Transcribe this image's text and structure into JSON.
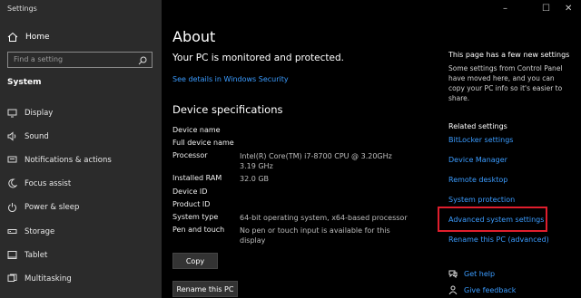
{
  "window": {
    "title": "Settings",
    "controls": [
      "–",
      "☐",
      "✕"
    ]
  },
  "sidebar": {
    "home_label": "Home",
    "search_placeholder": "Find a setting",
    "section_label": "System",
    "items": [
      {
        "label": "Display",
        "icon": "display-icon"
      },
      {
        "label": "Sound",
        "icon": "sound-icon"
      },
      {
        "label": "Notifications & actions",
        "icon": "notifications-icon"
      },
      {
        "label": "Focus assist",
        "icon": "moon-icon"
      },
      {
        "label": "Power & sleep",
        "icon": "power-icon"
      },
      {
        "label": "Storage",
        "icon": "storage-icon"
      },
      {
        "label": "Tablet",
        "icon": "tablet-icon"
      },
      {
        "label": "Multitasking",
        "icon": "multitasking-icon"
      }
    ]
  },
  "main": {
    "title": "About",
    "status": "Your PC is monitored and protected.",
    "security_link": "See details in Windows Security",
    "specs_heading": "Device specifications",
    "specs": [
      {
        "label": "Device name",
        "value": ""
      },
      {
        "label": "Full device name",
        "value": ""
      },
      {
        "label": "Processor",
        "value": "Intel(R) Core(TM) i7-8700 CPU @ 3.20GHz 3.19 GHz"
      },
      {
        "label": "Installed RAM",
        "value": "32.0 GB"
      },
      {
        "label": "Device ID",
        "value": ""
      },
      {
        "label": "Product ID",
        "value": ""
      },
      {
        "label": "System type",
        "value": "64-bit operating system, x64-based processor"
      },
      {
        "label": "Pen and touch",
        "value": "No pen or touch input is available for this display"
      }
    ],
    "copy_button": "Copy",
    "rename_button": "Rename this PC"
  },
  "right_panel": {
    "new_settings_title": "This page has a few new settings",
    "new_settings_body": "Some settings from Control Panel have moved here, and you can copy your PC info so it's easier to share.",
    "related_title": "Related settings",
    "links": [
      "BitLocker settings",
      "Device Manager",
      "Remote desktop",
      "System protection",
      "Advanced system settings",
      "Rename this PC (advanced)"
    ],
    "highlight_color": "#e01e2d",
    "get_help": "Get help",
    "give_feedback": "Give feedback"
  },
  "colors": {
    "accent": "#3b9cff",
    "sidebar_bg": "#2b2b2b",
    "main_bg": "#000000"
  }
}
